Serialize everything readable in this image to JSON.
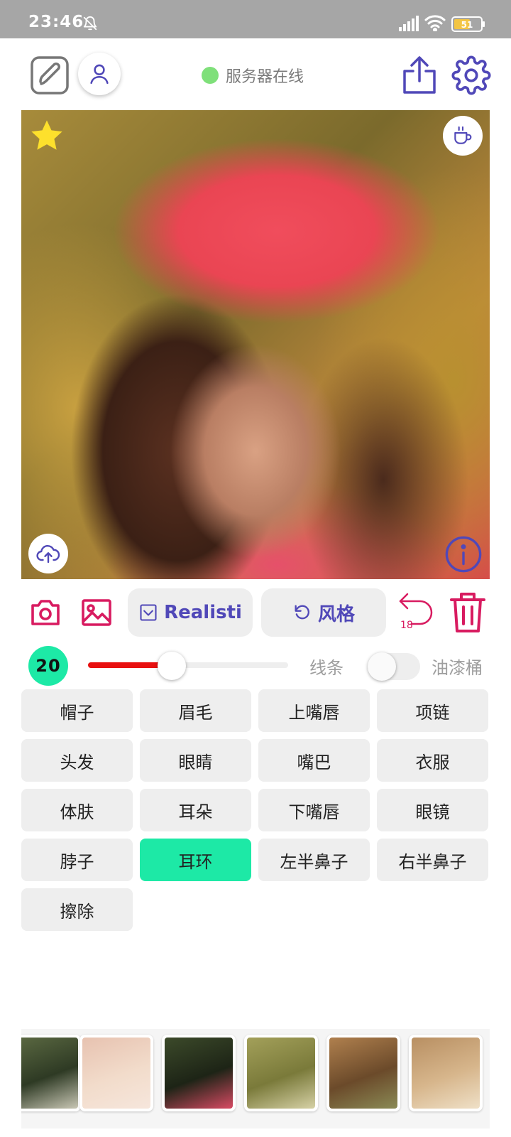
{
  "status_bar": {
    "time": "23:46",
    "battery_level": "51",
    "icons": [
      "bell-off-icon",
      "signal-icon",
      "wifi-icon",
      "battery-icon"
    ]
  },
  "toolbar": {
    "server_status": "服务器在线",
    "server_status_color": "#7fe07a",
    "icons": [
      "edit-icon",
      "user-icon",
      "share-icon",
      "gear-icon"
    ]
  },
  "canvas": {
    "icons": [
      "star-icon",
      "coffee-icon",
      "cloud-upload-icon",
      "info-icon"
    ]
  },
  "tools": {
    "mode_label": "Realisti",
    "style_label": "风格",
    "undo_count": "18",
    "icons": [
      "camera-icon",
      "image-icon",
      "checkbox-icon",
      "rotate-icon",
      "undo-icon",
      "trash-icon"
    ]
  },
  "brush": {
    "size": "20",
    "slider_fraction": 0.42,
    "line_label": "线条",
    "bucket_label": "油漆桶",
    "bucket_enabled": false
  },
  "parts": [
    {
      "label": "帽子",
      "active": false
    },
    {
      "label": "眉毛",
      "active": false
    },
    {
      "label": "上嘴唇",
      "active": false
    },
    {
      "label": "项链",
      "active": false
    },
    {
      "label": "头发",
      "active": false
    },
    {
      "label": "眼睛",
      "active": false
    },
    {
      "label": "嘴巴",
      "active": false
    },
    {
      "label": "衣服",
      "active": false
    },
    {
      "label": "体肤",
      "active": false
    },
    {
      "label": "耳朵",
      "active": false
    },
    {
      "label": "下嘴唇",
      "active": false
    },
    {
      "label": "眼镜",
      "active": false
    },
    {
      "label": "脖子",
      "active": false
    },
    {
      "label": "耳环",
      "active": true
    },
    {
      "label": "左半鼻子",
      "active": false
    },
    {
      "label": "右半鼻子",
      "active": false
    },
    {
      "label": "擦除",
      "active": false
    }
  ],
  "colors": {
    "accent": "#5048b8",
    "danger": "#d81b60",
    "active": "#1de9a6",
    "slider": "#e81010"
  },
  "thumbnails": [
    {
      "colors": [
        "#2e3a24",
        "#5d6b43",
        "#c9c7b5"
      ]
    },
    {
      "colors": [
        "#f2dccb",
        "#e7c2b0",
        "#f6e6dc"
      ]
    },
    {
      "colors": [
        "#1d2416",
        "#3c4a2a",
        "#d84a63"
      ]
    },
    {
      "colors": [
        "#7a7a3a",
        "#a3a05a",
        "#d6d1a6"
      ]
    },
    {
      "colors": [
        "#6b4a2a",
        "#b0804e",
        "#8a8a55"
      ]
    },
    {
      "colors": [
        "#d7b68c",
        "#b88f62",
        "#efe0c7"
      ]
    }
  ]
}
